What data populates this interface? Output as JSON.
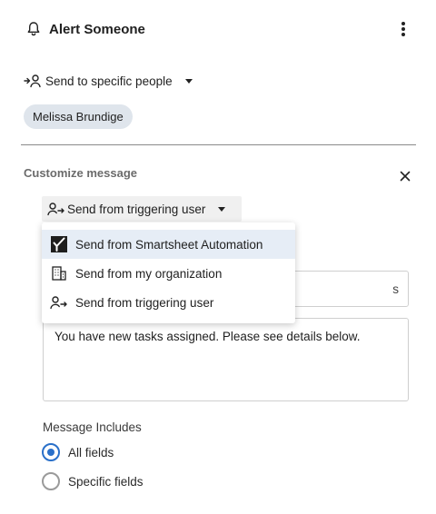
{
  "header": {
    "title": "Alert Someone"
  },
  "recipient": {
    "label": "Send to specific people",
    "chips": [
      "Melissa Brundige"
    ]
  },
  "customize": {
    "label": "Customize message",
    "sender_selected": "Send from triggering user",
    "menu_items": [
      {
        "label": "Send from Smartsheet Automation",
        "icon": "smartsheet-logo-icon"
      },
      {
        "label": "Send from my organization",
        "icon": "building-icon"
      },
      {
        "label": "Send from triggering user",
        "icon": "user-arrow-icon"
      }
    ],
    "subject_partial": "s",
    "message_body": "You have new tasks assigned. Please see details below."
  },
  "includes": {
    "label": "Message Includes",
    "options": [
      {
        "label": "All fields",
        "checked": true
      },
      {
        "label": "Specific fields",
        "checked": false
      }
    ]
  },
  "colors": {
    "accent": "#2a70c9",
    "chip_bg": "#dfe5ec",
    "menu_selected_bg": "#e6edf6"
  }
}
